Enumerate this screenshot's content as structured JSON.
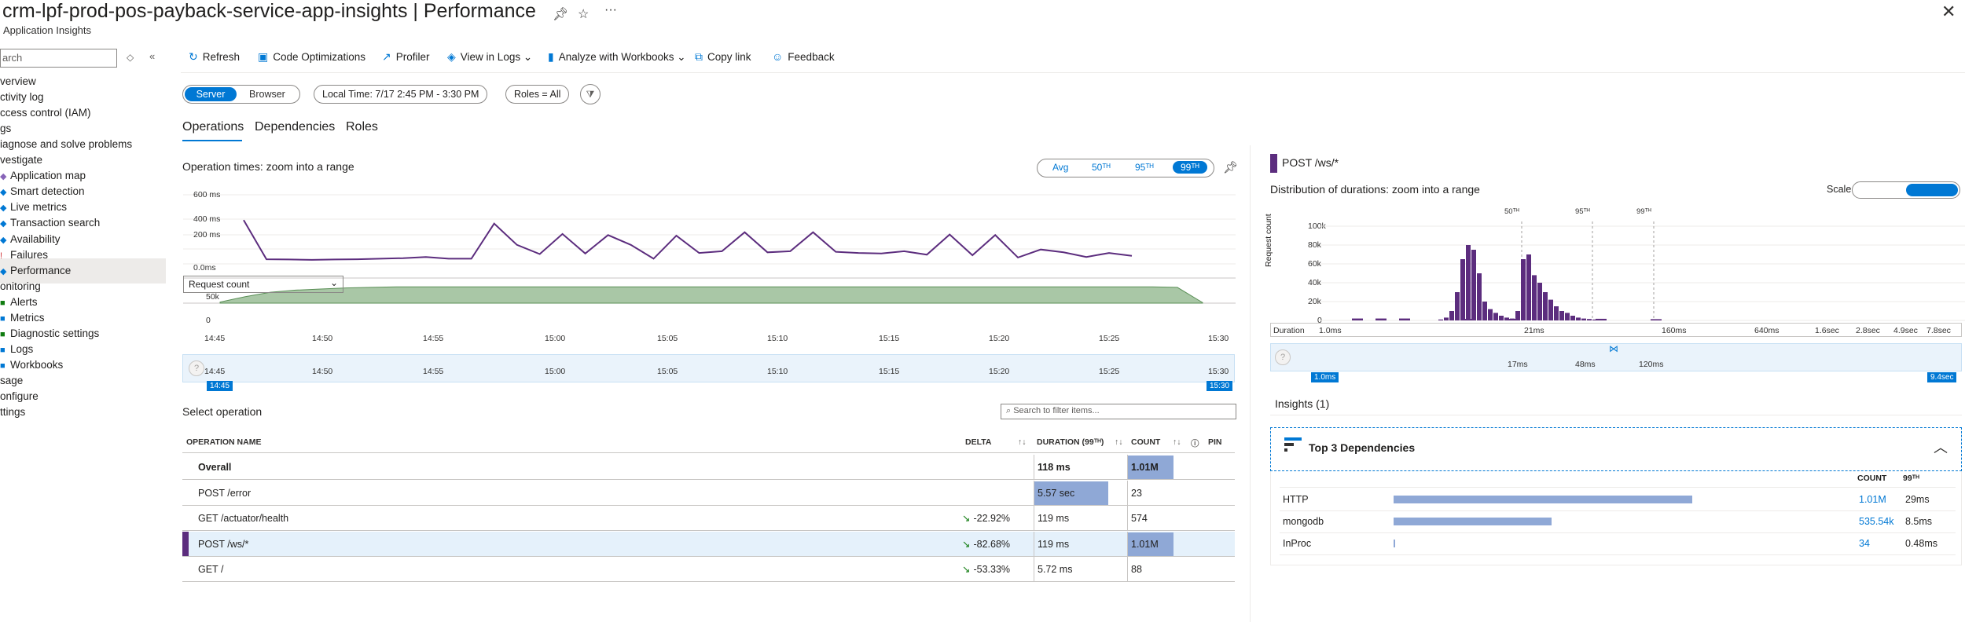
{
  "header": {
    "title": "crm-lpf-prod-pos-payback-service-app-insights | Performance",
    "subtitle": "Application Insights",
    "pin_icon": "pin-icon",
    "star_icon": "star-icon",
    "more_icon": "more-icon",
    "close_icon": "close-icon"
  },
  "sidebar": {
    "search_placeholder": "arch",
    "items": [
      {
        "label": "verview",
        "icon": ""
      },
      {
        "label": "ctivity log",
        "icon": ""
      },
      {
        "label": "ccess control (IAM)",
        "icon": ""
      },
      {
        "label": "gs",
        "icon": ""
      },
      {
        "label": "iagnose and solve problems",
        "icon": ""
      },
      {
        "label": "vestigate",
        "icon": ""
      },
      {
        "label": "Application map",
        "icon": "map-icon"
      },
      {
        "label": "Smart detection",
        "icon": "detection-icon"
      },
      {
        "label": "Live metrics",
        "icon": "live-icon"
      },
      {
        "label": "Transaction search",
        "icon": "search-icon"
      },
      {
        "label": "Availability",
        "icon": "availability-icon"
      },
      {
        "label": "Failures",
        "icon": "failures-icon"
      },
      {
        "label": "Performance",
        "icon": "performance-icon"
      },
      {
        "label": "onitoring",
        "icon": ""
      },
      {
        "label": "Alerts",
        "icon": "alerts-icon"
      },
      {
        "label": "Metrics",
        "icon": "metrics-icon"
      },
      {
        "label": "Diagnostic settings",
        "icon": "settings-icon"
      },
      {
        "label": "Logs",
        "icon": "logs-icon"
      },
      {
        "label": "Workbooks",
        "icon": "workbooks-icon"
      },
      {
        "label": "sage",
        "icon": ""
      },
      {
        "label": "onfigure",
        "icon": ""
      },
      {
        "label": "ttings",
        "icon": ""
      }
    ]
  },
  "toolbar": {
    "refresh": "Refresh",
    "code_opt": "Code Optimizations",
    "profiler": "Profiler",
    "view_logs": "View in Logs",
    "workbooks": "Analyze with Workbooks",
    "copy_link": "Copy link",
    "feedback": "Feedback"
  },
  "filters": {
    "server": "Server",
    "browser": "Browser",
    "time": "Local Time: 7/17 2:45 PM - 3:30 PM",
    "roles": "Roles = All"
  },
  "tabs": [
    "Operations",
    "Dependencies",
    "Roles"
  ],
  "operations_chart": {
    "title": "Operation times: zoom into a range",
    "seg_avg": "Avg",
    "seg_50": "50ᵀᴴ",
    "seg_95": "95ᵀᴴ",
    "seg_99": "99ᵀᴴ",
    "select_label": "Request count",
    "y_labels": [
      "600 ms",
      "400 ms",
      "200 ms",
      "0.0ms"
    ],
    "y2_labels": [
      "50k",
      "0"
    ],
    "x_labels": [
      "14:45",
      "14:50",
      "14:55",
      "15:00",
      "15:05",
      "15:10",
      "15:15",
      "15:20",
      "15:25",
      "15:30"
    ],
    "range_start": "14:45",
    "range_end": "15:30"
  },
  "chart_data": [
    {
      "type": "line",
      "title": "Operation times: zoom into a range",
      "ylim": [
        0,
        600
      ],
      "x": [
        "14:46",
        "14:47",
        "14:48",
        "14:50",
        "14:51",
        "14:52",
        "14:53",
        "14:54",
        "14:55",
        "14:56",
        "14:57",
        "14:58",
        "14:59",
        "15:00",
        "15:01",
        "15:02",
        "15:03",
        "15:04",
        "15:05",
        "15:06",
        "15:07",
        "15:08",
        "15:09",
        "15:10",
        "15:11",
        "15:12",
        "15:13",
        "15:14",
        "15:15",
        "15:16",
        "15:17",
        "15:18",
        "15:19",
        "15:20",
        "15:21",
        "15:22",
        "15:23",
        "15:24",
        "15:25",
        "15:26"
      ],
      "series": [
        {
          "values": [
            380,
            40,
            38,
            35,
            38,
            40,
            45,
            50,
            60,
            45,
            45,
            350,
            165,
            85,
            260,
            90,
            250,
            165,
            45,
            245,
            95,
            110,
            275,
            100,
            110,
            275,
            105,
            95,
            90,
            110,
            80,
            255,
            75,
            250,
            55,
            125,
            100,
            60,
            95,
            70
          ]
        }
      ]
    },
    {
      "type": "area",
      "select": "Request count",
      "ylim": [
        0,
        60000
      ],
      "series": [
        {
          "values": [
            2000,
            12000,
            20000,
            24000,
            26000,
            28000,
            29000,
            30000,
            30000,
            30000,
            30000,
            30000,
            30000,
            30000,
            30000,
            30000,
            30000,
            30000,
            30000,
            30000,
            30000,
            30000,
            30000,
            30000,
            30000,
            30000,
            30000,
            30000,
            30000,
            30000,
            30000,
            30000,
            30000,
            30000,
            30000,
            30000,
            30000,
            30000,
            29000,
            1000
          ]
        }
      ]
    },
    {
      "type": "bar",
      "title": "Distribution of durations: zoom into a range",
      "xlabel": "Duration",
      "ylabel": "Request count",
      "ylim": [
        0,
        100000
      ],
      "x_tick_labels": [
        "1.0ms",
        "21ms",
        "160ms",
        "640ms",
        "1.6sec",
        "2.8sec",
        "4.9sec",
        "7.8sec"
      ],
      "values": [
        1000,
        3000,
        10000,
        30000,
        65000,
        80000,
        75000,
        50000,
        20000,
        12000,
        8000,
        5000,
        3000,
        2000,
        10000,
        65000,
        70000,
        48000,
        40000,
        30000,
        22000,
        15000,
        10000,
        8000,
        5000,
        3000,
        2000,
        1500,
        1000,
        800
      ]
    }
  ],
  "operations_table": {
    "select_title": "Select operation",
    "filter_placeholder": "Search to filter items...",
    "columns": [
      "OPERATION NAME",
      "DELTA",
      "DURATION (99ᵀᴴ)",
      "COUNT",
      "PIN"
    ],
    "rows": [
      {
        "name": "Overall",
        "delta": "",
        "duration": "118 ms",
        "count": "1.01M",
        "bold": true,
        "dur_bar": 0,
        "count_bar": 1.0
      },
      {
        "name": "POST /error",
        "delta": "",
        "duration": "5.57 sec",
        "count": "23",
        "bold": false,
        "dur_bar": 1.0,
        "count_bar": 0
      },
      {
        "name": "GET /actuator/health",
        "delta": "-22.92%",
        "duration": "119 ms",
        "count": "574",
        "bold": false,
        "dur_bar": 0,
        "count_bar": 0
      },
      {
        "name": "POST /ws/*",
        "delta": "-82.68%",
        "duration": "119 ms",
        "count": "1.01M",
        "bold": false,
        "dur_bar": 0,
        "count_bar": 1.0
      },
      {
        "name": "GET /",
        "delta": "-53.33%",
        "duration": "5.72 ms",
        "count": "88",
        "bold": false,
        "dur_bar": 0,
        "count_bar": 0
      }
    ]
  },
  "right_panel": {
    "op_title": "POST /ws/*",
    "dist_title": "Distribution of durations: zoom into a range",
    "scale_label": "Scale",
    "y_axis_title": "Request count",
    "y_labels": [
      "100k",
      "80k",
      "60k",
      "40k",
      "20k",
      "0"
    ],
    "pct_labels": [
      "50ᵀᴴ",
      "95ᵀᴴ",
      "99ᵀᴴ"
    ],
    "duration_label": "Duration",
    "dist_x_labels": [
      "1.0ms",
      "21ms",
      "160ms",
      "640ms",
      "1.6sec",
      "2.8sec",
      "4.9sec",
      "7.8sec"
    ],
    "range_x_labels": [
      "17ms",
      "48ms",
      "120ms"
    ],
    "range_start": "1.0ms",
    "range_end": "9.4sec",
    "insights_title": "Insights (1)",
    "card_title": "Top 3 Dependencies",
    "col_count": "COUNT",
    "col_99": "99ᵀᴴ",
    "deps": [
      {
        "name": "HTTP",
        "count": "1.01M",
        "p99": "29ms",
        "fraction": 1.0
      },
      {
        "name": "mongodb",
        "count": "535.54k",
        "p99": "8.5ms",
        "fraction": 0.53
      },
      {
        "name": "InProc",
        "count": "34",
        "p99": "0.48ms",
        "fraction": 0.005
      }
    ]
  }
}
